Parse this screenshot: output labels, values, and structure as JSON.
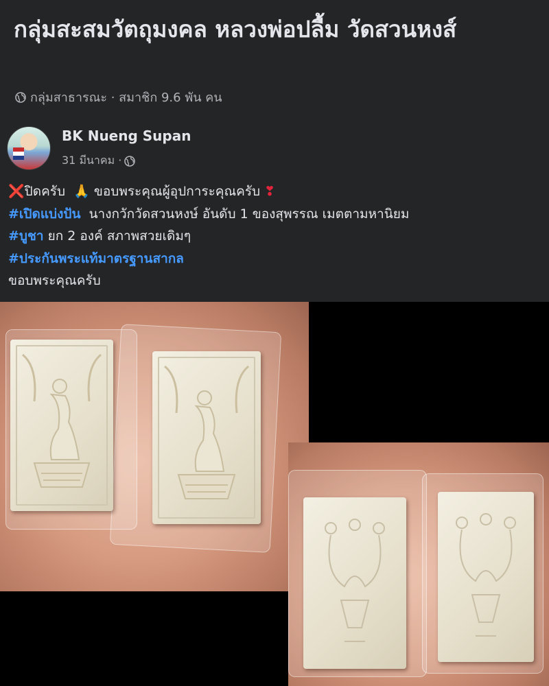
{
  "group": {
    "title": "กลุ่มสะสมวัตถุมงคล หลวงพ่อปลื้ม วัดสวนหงส์",
    "meta": "กลุ่มสาธารณะ · สมาชิก 9.6 พัน คน",
    "meta_icon": "globe-icon"
  },
  "post": {
    "author": "BK Nueng Supan",
    "time": "31 มีนาคม ·",
    "time_icon": "globe-icon",
    "lines": {
      "l1_text1": "ปิดครับ",
      "l1_text2": "ขอบพระคุณผู้อุปการะคุณครับ",
      "l1_emoji_x": "❌",
      "l1_emoji_pray": "🙏",
      "l1_emoji_heart": "❣",
      "l2_tag": "#เปิดแบ่งปัน",
      "l2_text": "นางกวักวัดสวนหงษ์ อันดับ 1 ของสุพรรณ เมตตามหานิยม",
      "l3_tag": "#บูชา",
      "l3_text": "ยก 2 องค์ สภาพสวยเดิมๆ",
      "l4_tag": "#ประกันพระแท้มาตรฐานสากล",
      "l5_text": "ขอบพระคุณครับ"
    }
  },
  "colors": {
    "card_bg": "#242526",
    "text": "#e4e6eb",
    "secondary": "#b0b3b8",
    "hashtag": "#4599ff"
  }
}
